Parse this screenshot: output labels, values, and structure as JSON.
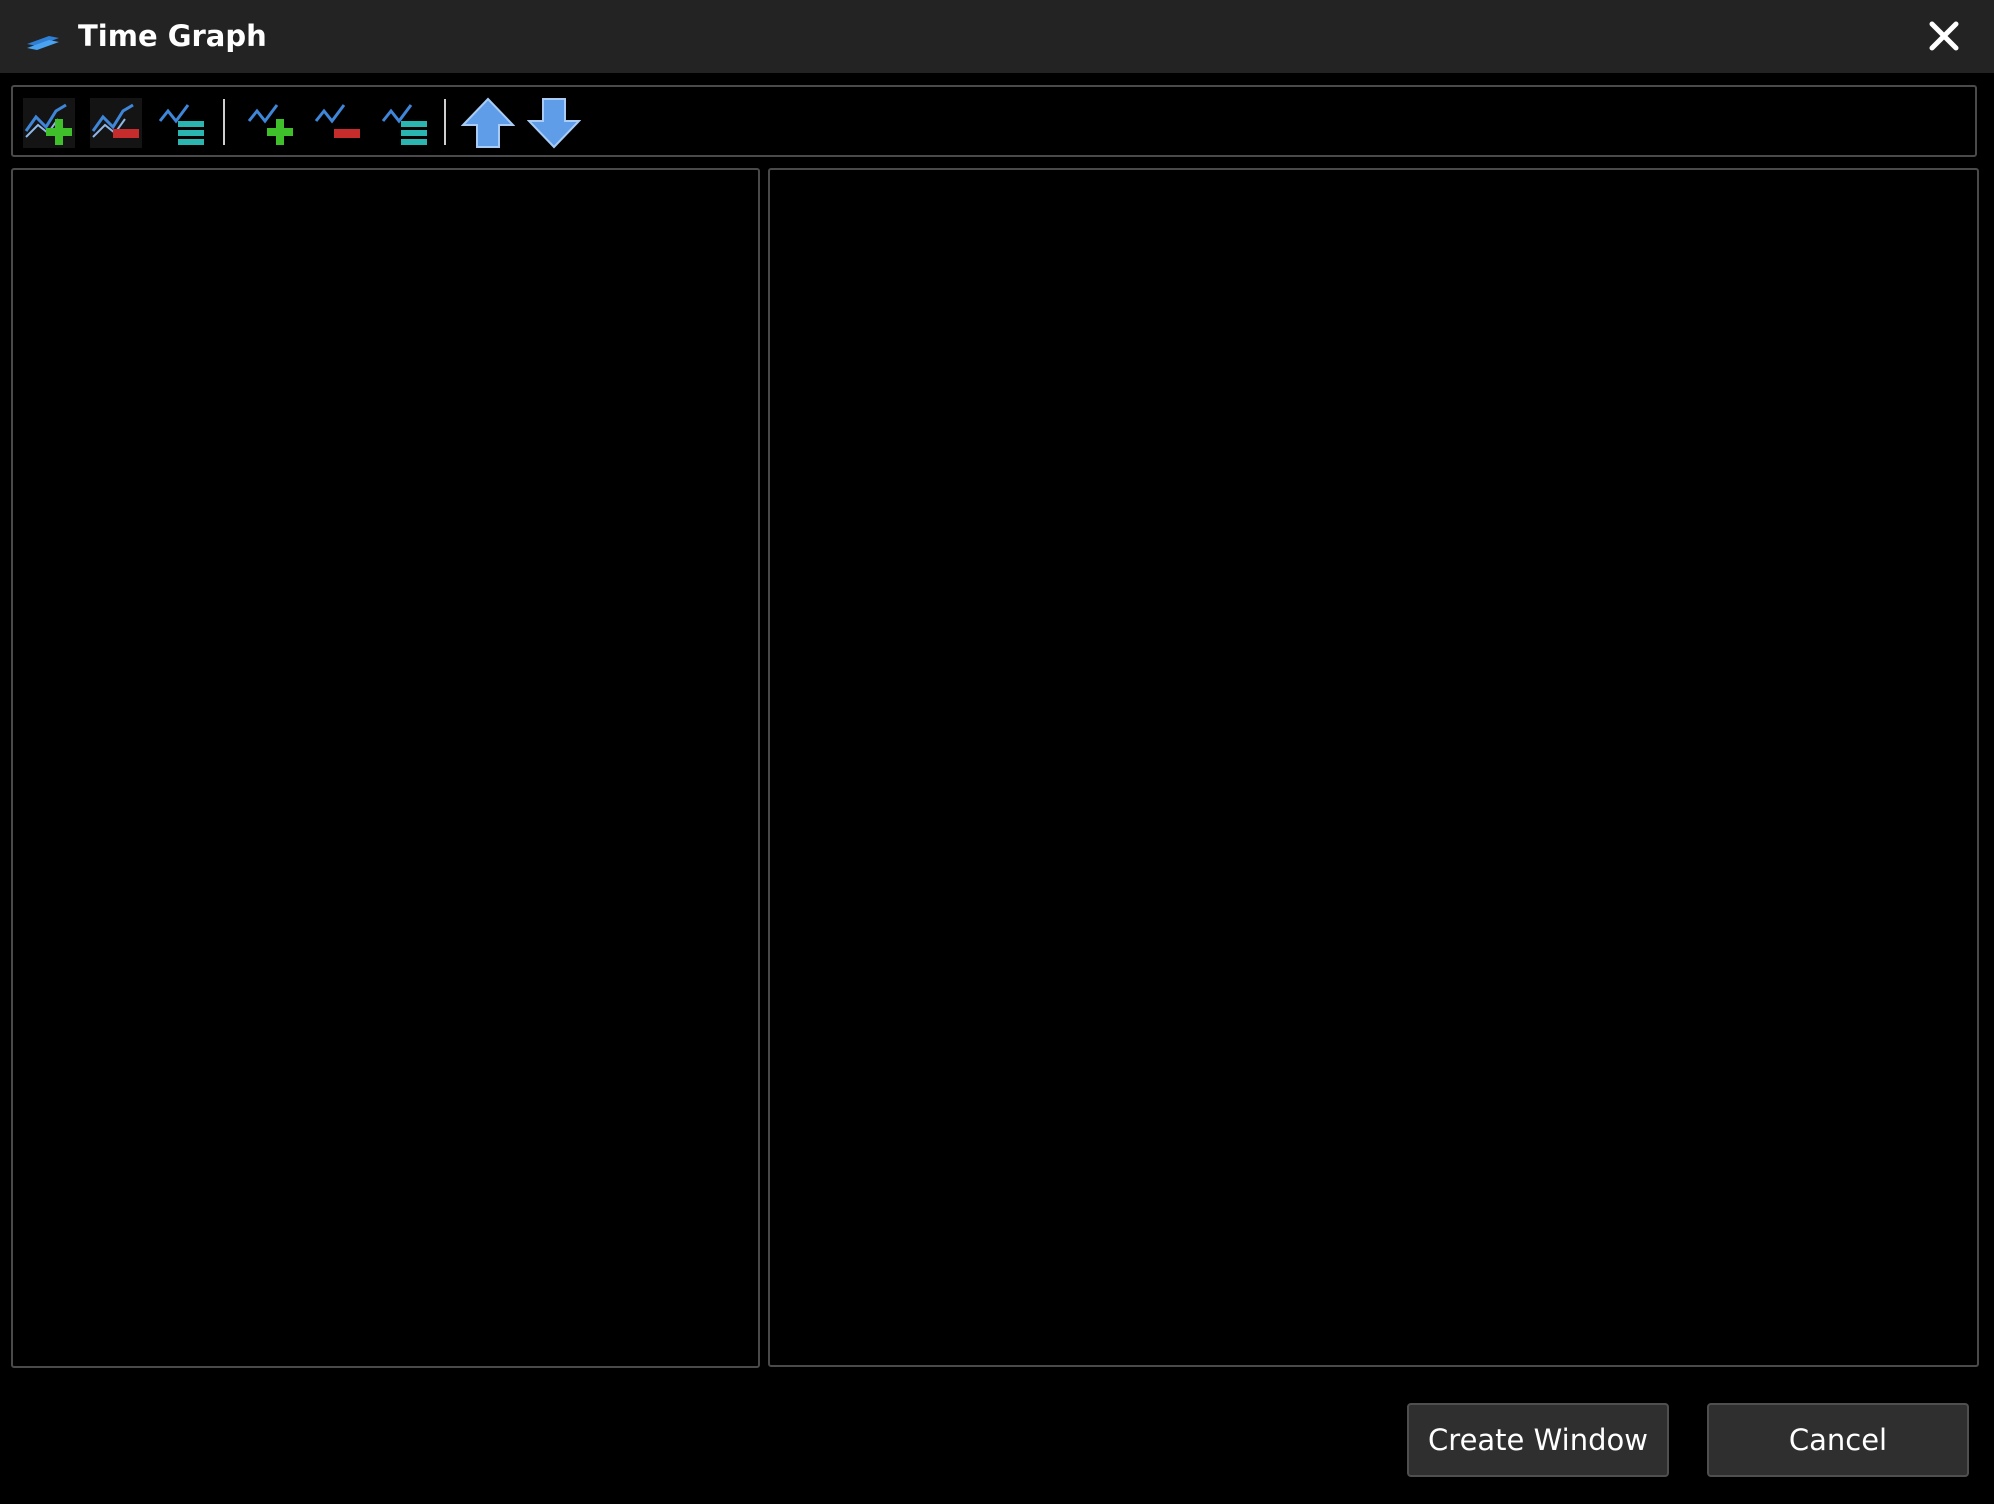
{
  "window": {
    "title": "Time Graph",
    "icon": "layers-icon"
  },
  "toolbar": {
    "groups": [
      [
        {
          "icon": "add-graph-icon"
        },
        {
          "icon": "remove-graph-icon"
        },
        {
          "icon": "graph-properties-icon"
        }
      ],
      [
        {
          "icon": "add-series-icon"
        },
        {
          "icon": "remove-series-icon"
        },
        {
          "icon": "series-properties-icon"
        }
      ],
      [
        {
          "icon": "move-up-icon"
        },
        {
          "icon": "move-down-icon"
        }
      ]
    ]
  },
  "footer": {
    "create_label": "Create Window",
    "cancel_label": "Cancel"
  },
  "colors": {
    "titlebar_bg": "#232323",
    "window_bg": "#000000",
    "border": "#4a4a4a",
    "button_bg": "#2f2f2f",
    "add_green": "#3fbf2a",
    "remove_red": "#c62c2c",
    "props_teal": "#2bb5b0",
    "arrow_blue": "#5f9de8",
    "line_blue": "#3f86d8"
  }
}
